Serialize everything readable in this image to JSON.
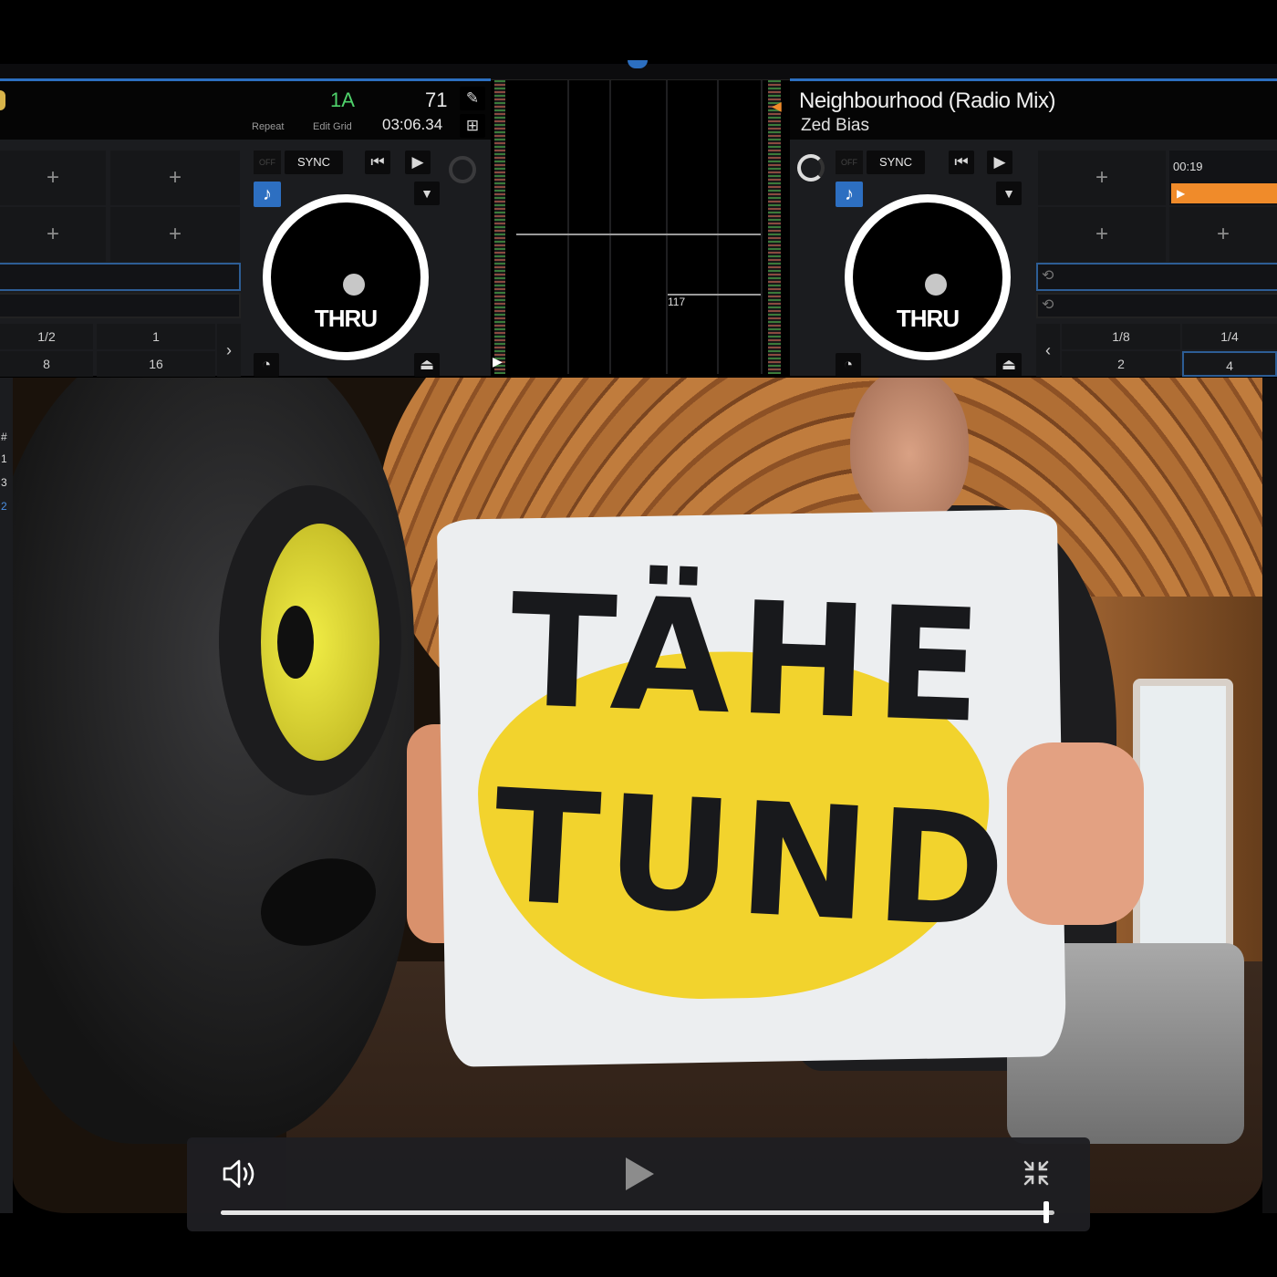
{
  "left_deck": {
    "key": "1A",
    "bpm": "71",
    "repeat_label": "Repeat",
    "edit_grid_label": "Edit Grid",
    "time": "03:06.34",
    "off_label": "OFF",
    "sync_label": "SYNC",
    "platter_label": "THRU",
    "hotcue_labels": [
      "+",
      "+",
      "+",
      "+"
    ],
    "loop_sizes": [
      "1/2",
      "1",
      "8",
      "16"
    ]
  },
  "right_deck": {
    "title": "Neighbourhood (Radio Mix)",
    "artist": "Zed Bias",
    "off_label": "OFF",
    "sync_label": "SYNC",
    "platter_label": "THRU",
    "elapsed": "00:19",
    "hotcue_labels": [
      "+",
      "+",
      "+"
    ],
    "loop_sizes": [
      "1/8",
      "1/4",
      "2",
      "4"
    ]
  },
  "center": {
    "beat_marker": "117"
  },
  "left_strip_chars": [
    "#",
    "1",
    "3",
    "2"
  ],
  "video": {
    "sign_line1": "TÄHE",
    "sign_line2": "TUND"
  },
  "player": {
    "progress": 0.99,
    "icons": {
      "mute": "speaker-volume-icon",
      "play": "play-icon",
      "exit_fullscreen": "exit-fullscreen-icon"
    }
  },
  "colors": {
    "accent_blue": "#2c6fc0",
    "key_green": "#4fd26b",
    "orange_marker": "#f08b2a",
    "sign_yellow": "#f2d32d"
  }
}
